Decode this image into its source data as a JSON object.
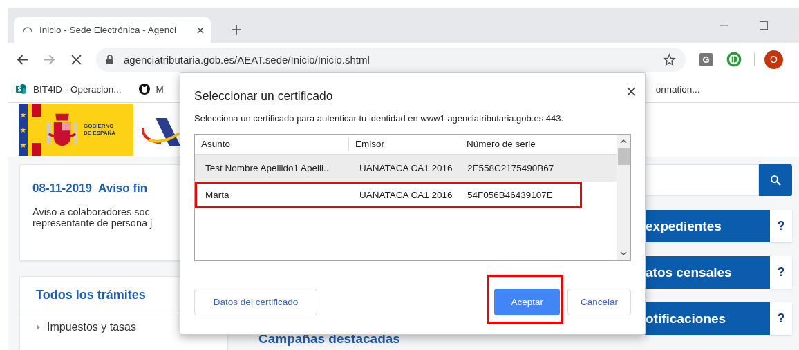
{
  "browser": {
    "tab": {
      "title": "Inicio - Sede Electrónica - Agenci",
      "loading": true
    },
    "address": "agenciatributaria.gob.es/AEAT.sede/Inicio/Inicio.shtml",
    "extension_letter": "G",
    "avatar": "O",
    "bookmarks": [
      {
        "label": "BIT4ID - Operacion...",
        "kind": "sharepoint"
      },
      {
        "label": "M",
        "kind": "github"
      },
      {
        "label": "ormation...",
        "kind": "none"
      }
    ]
  },
  "header": {
    "government_label": "GOBIERNO DE ESPAÑA"
  },
  "notice": {
    "date": "08-11-2019",
    "title": "Aviso fin",
    "text": "Aviso a colaboradores soc\nrepresentante de persona j"
  },
  "procedures": {
    "title": "Todos los trámites",
    "items": [
      "Impuestos y tasas"
    ]
  },
  "campaigns_title": "Campañas destacadas",
  "quick_links": [
    {
      "label": "expedientes",
      "help": "?"
    },
    {
      "label": "atos censales",
      "help": "?"
    },
    {
      "label": "otificaciones",
      "help": "?"
    }
  ],
  "dialog": {
    "title": "Seleccionar un certificado",
    "subtitle": "Selecciona un certificado para autenticar tu identidad en www1.agenciatributaria.gob.es:443.",
    "columns": [
      "Asunto",
      "Emisor",
      "Número de serie"
    ],
    "rows": [
      {
        "subject": "Test Nombre Apellido1 Apelli...",
        "issuer": "UANATACA CA1 2016",
        "serial": "2E558C2175490B67",
        "selected": true,
        "annotated": false
      },
      {
        "subject": "Marta",
        "issuer": "UANATACA CA1 2016",
        "serial": "54F056B46439107E",
        "selected": false,
        "annotated": true
      }
    ],
    "buttons": [
      {
        "label": "Datos del certificado",
        "kind": "secondary",
        "annotated": false
      },
      {
        "label": "Aceptar",
        "kind": "primary",
        "annotated": true
      },
      {
        "label": "Cancelar",
        "kind": "secondary",
        "annotated": false
      }
    ]
  }
}
